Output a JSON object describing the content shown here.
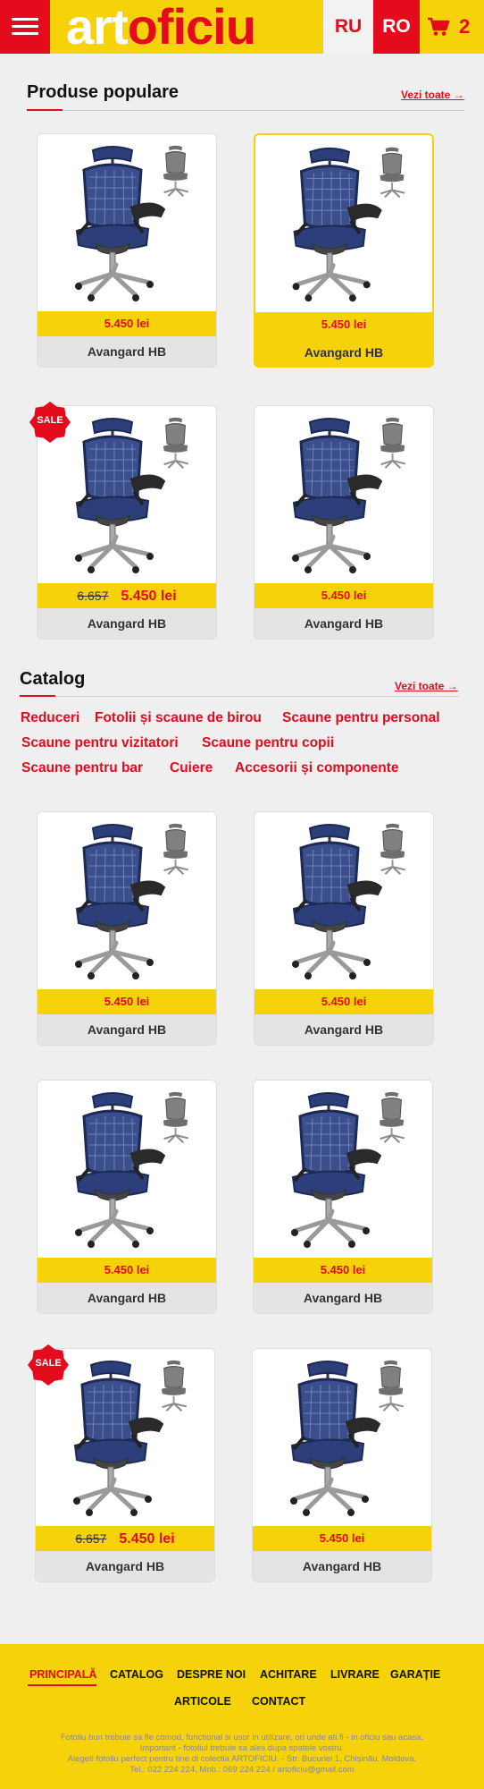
{
  "header": {
    "logo_part1": "art",
    "logo_part2": "oficiu",
    "lang_ru": "RU",
    "lang_ro": "RO",
    "cart_count": "2",
    "menu_icon": "hamburger-icon",
    "cart_icon": "cart-icon"
  },
  "popular": {
    "title": "Produse populare",
    "view_all": "Vezi toate →",
    "products": [
      {
        "name": "Avangard HB",
        "price": "5.450 lei"
      },
      {
        "name": "Avangard HB",
        "price": "5.450 lei"
      },
      {
        "name": "Avangard HB",
        "price": "5.450 lei",
        "old_price": "6.657",
        "sale": "SALE"
      },
      {
        "name": "Avangard HB",
        "price": "5.450 lei"
      }
    ]
  },
  "catalog": {
    "title": "Catalog",
    "view_all": "Vezi toate →",
    "categories": [
      "Reduceri",
      "Fotolii și scaune de birou",
      "Scaune pentru personal",
      "Scaune pentru vizitatori",
      "Scaune pentru copii",
      "Scaune pentru bar",
      "Cuiere",
      "Accesorii și componente"
    ],
    "products": [
      {
        "name": "Avangard HB",
        "price": "5.450 lei"
      },
      {
        "name": "Avangard HB",
        "price": "5.450 lei"
      },
      {
        "name": "Avangard HB",
        "price": "5.450 lei"
      },
      {
        "name": "Avangard HB",
        "price": "5.450 lei"
      },
      {
        "name": "Avangard HB",
        "price": "5.450 lei",
        "old_price": "6.657",
        "sale": "SALE"
      },
      {
        "name": "Avangard HB",
        "price": "5.450 lei"
      }
    ]
  },
  "footer": {
    "nav": [
      "PRINCIPALĂ",
      "CATALOG",
      "DESPRE NOI",
      "ACHITARE",
      "LIVRARE",
      "GARAȚIE",
      "ARTICOLE",
      "CONTACT"
    ],
    "text1": "Fotoliu bun trebuie sa fie comod, functional si usor in utilizare, ori unde ati fi - in oficiu sau acasa.",
    "text2": "Important - fotoliul trebuie sa ales dupa spatele vostru.",
    "text3": "Alegeti fotoliu perfect pentru tine di colectia ARTOFICIU. - Str. Bucuriei 1, Chișinău, Moldova.",
    "text4": "Tel.: 022 224 224, Mob.: 069 224 224 / artoficiu@gmail.com"
  },
  "colors": {
    "brand_red": "#e30b1c",
    "brand_yellow": "#f5d20a"
  }
}
